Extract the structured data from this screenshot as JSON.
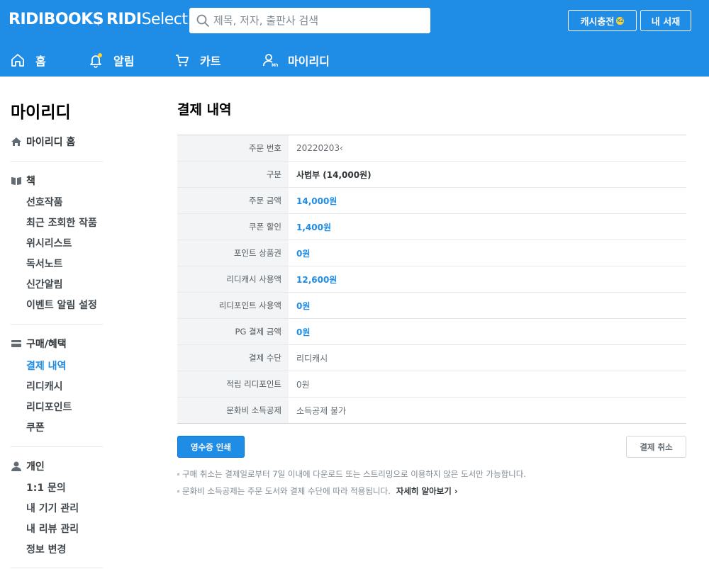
{
  "header": {
    "logo_main": "RIDIBOOKS",
    "logo_select_bold": "RIDI",
    "logo_select_rest": "Select",
    "search_placeholder": "제목, 저자, 출판사 검색",
    "cash_button": "캐시충전",
    "cash_badge": "x2",
    "library_button": "내 서재"
  },
  "gnb": {
    "home": "홈",
    "notice": "알림",
    "cart": "카트",
    "my": "마이리디",
    "my_icon_text": "MY"
  },
  "sidebar": {
    "title": "마이리디",
    "home": "마이리디 홈",
    "books": {
      "title": "책",
      "items": [
        "선호작품",
        "최근 조회한 작품",
        "위시리스트",
        "독서노트",
        "신간알림",
        "이벤트 알림 설정"
      ]
    },
    "purchase": {
      "title": "구매/혜택",
      "items": [
        "결제 내역",
        "리디캐시",
        "리디포인트",
        "쿠폰"
      ]
    },
    "personal": {
      "title": "개인",
      "items": [
        "1:1 문의",
        "내 기기 관리",
        "내 리뷰 관리",
        "정보 변경"
      ]
    }
  },
  "main": {
    "title": "결제 내역",
    "rows": [
      {
        "label": "주문 번호",
        "value": "20220203‹"
      },
      {
        "label": "구분",
        "value": "사법부 (14,000원)"
      },
      {
        "label": "주문 금액",
        "value": "14,000원"
      },
      {
        "label": "쿠폰 할인",
        "value": "1,400원"
      },
      {
        "label": "포인트 상품권",
        "value": "0원"
      },
      {
        "label": "리디캐시 사용액",
        "value": "12,600원"
      },
      {
        "label": "리디포인트 사용액",
        "value": "0원"
      },
      {
        "label": "PG 결제 금액",
        "value": "0원"
      },
      {
        "label": "결제 수단",
        "value": "리디캐시"
      },
      {
        "label": "적립 리디포인트",
        "value": "0원"
      },
      {
        "label": "문화비 소득공제",
        "value": "소득공제 불가"
      }
    ],
    "receipt_button": "영수증 인쇄",
    "cancel_button": "결제 취소",
    "notes": [
      "구매 취소는 결제일로부터 7일 이내에 다운로드 또는 스트리밍으로 이용하지 않은 도서만 가능합니다.",
      "문화비 소득공제는 주문 도서와 결제 수단에 따라 적용됩니다."
    ],
    "more_link": "자세히 알아보기 ›"
  },
  "colors": {
    "brand_blue": "#1f8ce6",
    "badge_yellow": "#ffd32a"
  },
  "icons": [
    "search-icon",
    "home-icon",
    "bell-icon",
    "cart-icon",
    "user-icon",
    "book-icon",
    "card-icon",
    "person-icon"
  ]
}
